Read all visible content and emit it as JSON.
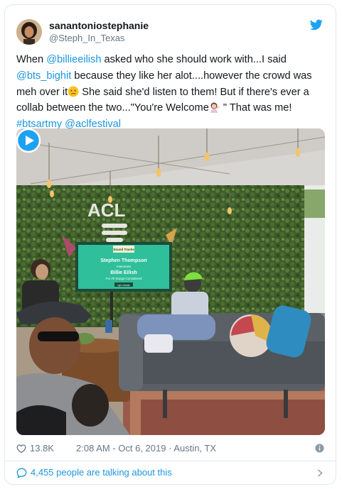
{
  "author": {
    "display_name": "sanantoniostephanie",
    "handle": "@Steph_In_Texas"
  },
  "tweet": {
    "segments": [
      {
        "type": "text",
        "text": "When "
      },
      {
        "type": "mention",
        "text": "@billieeilish"
      },
      {
        "type": "text",
        "text": " asked who she should work with...I said "
      },
      {
        "type": "mention",
        "text": "@bts_bighit"
      },
      {
        "type": "text",
        "text": " because they like her alot....however the crowd was meh over it"
      },
      {
        "type": "emoji",
        "name": "confused-face-emoji"
      },
      {
        "type": "text",
        "text": " She said she'd listen to them! But if there's ever a collab between the two...\"You're Welcome"
      },
      {
        "type": "emoji",
        "name": "person-tipping-hand-emoji"
      },
      {
        "type": "text",
        "text": " \" That was me! "
      },
      {
        "type": "hashtag",
        "text": "#btsartmy"
      },
      {
        "type": "text",
        "text": " "
      },
      {
        "type": "mention",
        "text": "@aclfestival"
      }
    ]
  },
  "media": {
    "acl_sign": "ACL",
    "screen_logo": "Sound Tracks",
    "screen_host": "Stephen Thompson",
    "screen_interviews": "Interviews",
    "screen_guest": "Billie Eilish",
    "screen_show": "For All Songs Considered",
    "screen_brand": "npr music"
  },
  "footer": {
    "likes": "13.8K",
    "timestamp": "2:08 AM - Oct 6, 2019 · Austin, TX"
  },
  "talk": {
    "label": "4,455 people are talking about this"
  },
  "colors": {
    "link": "#1b95e0",
    "text": "#14171a",
    "meta": "#657786",
    "border": "#e1e8ed"
  },
  "icons": [
    "twitter-bird-icon",
    "heart-icon",
    "info-icon",
    "speech-bubble-icon",
    "chevron-right-icon",
    "play-icon"
  ]
}
